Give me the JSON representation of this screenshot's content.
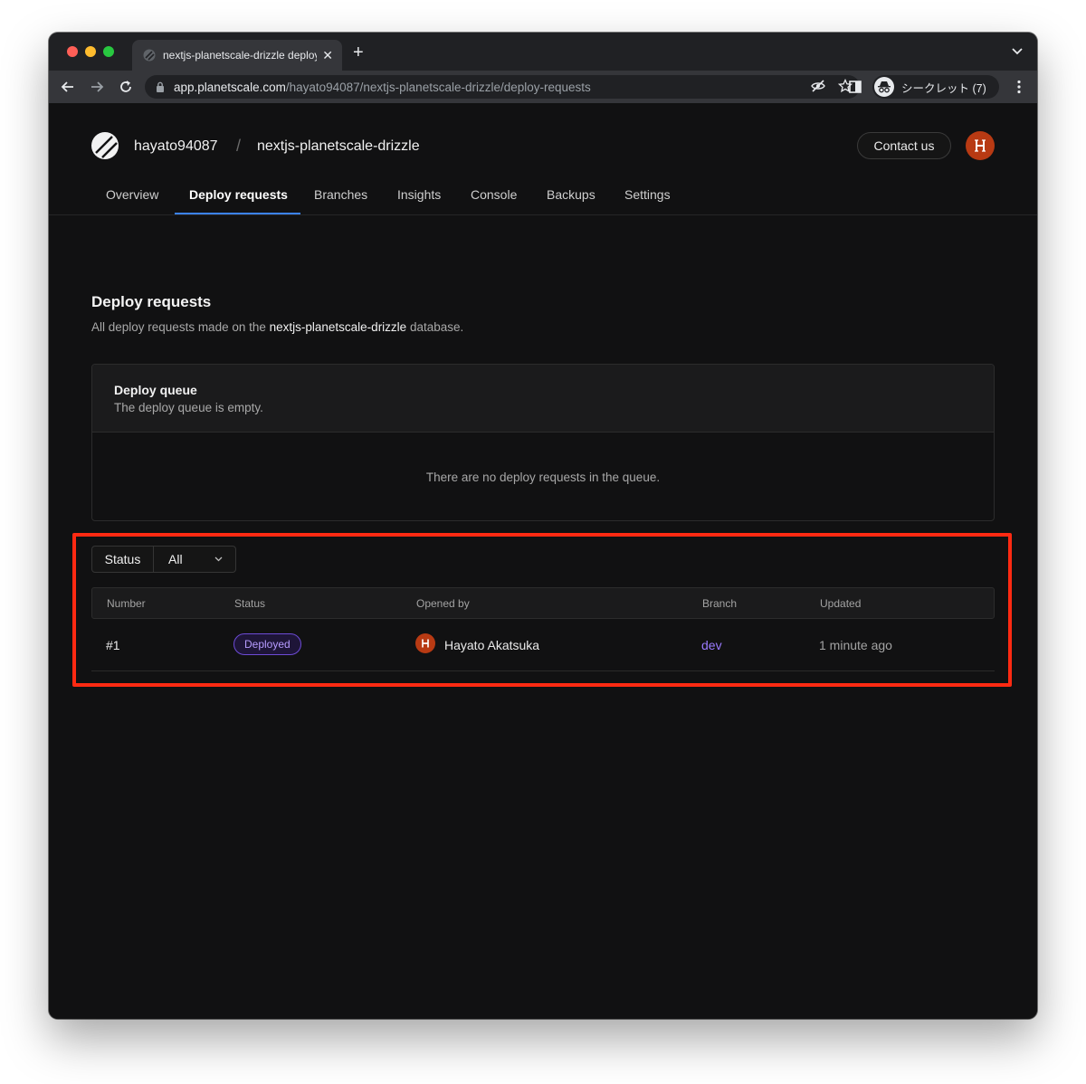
{
  "browser": {
    "tab_title": "nextjs-planetscale-drizzle deploy requests",
    "tab_close": "✕",
    "new_tab": "+",
    "url_host": "app.planetscale.com",
    "url_path": "/hayato94087/nextjs-planetscale-drizzle/deploy-requests",
    "incognito_label": "シークレット (7)"
  },
  "header": {
    "org": "hayato94087",
    "separator": "/",
    "database": "nextjs-planetscale-drizzle",
    "contact_label": "Contact us"
  },
  "nav": {
    "tabs": [
      {
        "label": "Overview",
        "active": false
      },
      {
        "label": "Deploy requests",
        "active": true
      },
      {
        "label": "Branches",
        "active": false
      },
      {
        "label": "Insights",
        "active": false
      },
      {
        "label": "Console",
        "active": false
      },
      {
        "label": "Backups",
        "active": false
      },
      {
        "label": "Settings",
        "active": false
      }
    ]
  },
  "main": {
    "title": "Deploy requests",
    "subtitle_prefix": "All deploy requests made on the ",
    "subtitle_db": "nextjs-planetscale-drizzle",
    "subtitle_suffix": " database."
  },
  "queue": {
    "title": "Deploy queue",
    "description": "The deploy queue is empty.",
    "empty_message": "There are no deploy requests in the queue."
  },
  "filter": {
    "label": "Status",
    "value": "All"
  },
  "table": {
    "columns": [
      "Number",
      "Status",
      "Opened by",
      "Branch",
      "Updated"
    ],
    "rows": [
      {
        "number": "#1",
        "status": "Deployed",
        "opened_by": "Hayato Akatsuka",
        "branch": "dev",
        "updated": "1 minute ago"
      }
    ]
  },
  "colors": {
    "accent": "#3b82f6",
    "badge": "#6d4bd6",
    "branch_link": "#9b7bff",
    "avatar": "#b83a13",
    "highlight": "#ff2a12"
  }
}
